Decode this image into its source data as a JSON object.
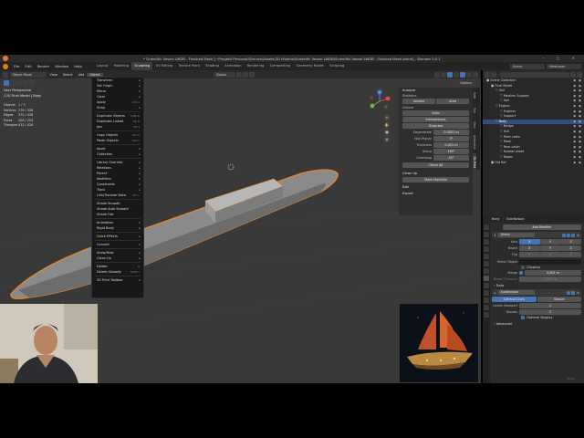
{
  "window": {
    "title": "* Scientific Vessel LWDB - Finished Mesh [~Progetti Personali\\Secure\\Assets\\3D Models\\Scientific Vessel LWDB\\Scientific Vessel LWDB - Finished Mesh.blend] - Blender 5.0.1",
    "buttons": "–  ▢  ✕"
  },
  "menus": [
    "File",
    "Edit",
    "Render",
    "Window",
    "Help"
  ],
  "workspaces": [
    "Layout",
    "Modeling",
    "Sculpting",
    "UV Editing",
    "Texture Paint",
    "Shading",
    "Animation",
    "Rendering",
    "Compositing",
    "Geometry Nodes",
    "Scripting"
  ],
  "active_workspace_index": 2,
  "scene": {
    "label": "Scene",
    "view_layer": "ViewLayer"
  },
  "viewport_header": {
    "mode": "Object Mode",
    "menus": [
      "View",
      "Select",
      "Add",
      "Object"
    ],
    "orientation": "Global",
    "options": "Options"
  },
  "viewport_overlay": {
    "line1": "User Perspective",
    "line2": "(10) Final Model | Body"
  },
  "stats": [
    {
      "k": "Objects",
      "v": "1 / 3"
    },
    {
      "k": "Vertices",
      "v": "276 / 328"
    },
    {
      "k": "Edges",
      "v": "370 / 436"
    },
    {
      "k": "Faces",
      "v": "208 / 254"
    },
    {
      "k": "Triangles",
      "v": "412 / 428"
    }
  ],
  "object_menu": [
    {
      "label": "Transform",
      "arrow": "▸"
    },
    {
      "label": "Set Origin",
      "arrow": "▸"
    },
    {
      "label": "Mirror",
      "arrow": "▸"
    },
    {
      "label": "Clear",
      "arrow": "▸"
    },
    {
      "label": "Apply",
      "sc": "Ctrl A"
    },
    {
      "label": "Snap",
      "arrow": "▸"
    },
    {
      "sep": true
    },
    {
      "label": "Duplicate Objects",
      "sc": "Shift D"
    },
    {
      "label": "Duplicate Linked",
      "sc": "Alt D"
    },
    {
      "label": "Join",
      "sc": "Ctrl J"
    },
    {
      "sep": true
    },
    {
      "label": "Copy Objects",
      "sc": "Ctrl C"
    },
    {
      "label": "Paste Objects",
      "sc": "Ctrl V"
    },
    {
      "sep": true
    },
    {
      "label": "Asset",
      "arrow": "▸"
    },
    {
      "label": "Collection",
      "arrow": "▸"
    },
    {
      "sep": true
    },
    {
      "label": "Library Override",
      "arrow": "▸"
    },
    {
      "label": "Relations",
      "arrow": "▸"
    },
    {
      "label": "Parent",
      "arrow": "▸"
    },
    {
      "label": "Modifiers",
      "arrow": "▸"
    },
    {
      "label": "Constraints",
      "arrow": "▸"
    },
    {
      "label": "Track",
      "arrow": "▸"
    },
    {
      "label": "Link/Transfer Data",
      "sc": "Ctrl L"
    },
    {
      "sep": true
    },
    {
      "label": "Shade Smooth"
    },
    {
      "label": "Shade Auto Smooth"
    },
    {
      "label": "Shade Flat"
    },
    {
      "sep": true
    },
    {
      "label": "Animation",
      "arrow": "▸"
    },
    {
      "label": "Rigid Body",
      "arrow": "▸"
    },
    {
      "sep": true
    },
    {
      "label": "Quick Effects",
      "arrow": "▸"
    },
    {
      "sep": true
    },
    {
      "label": "Convert",
      "arrow": "▸"
    },
    {
      "sep": true
    },
    {
      "label": "Show/Hide",
      "arrow": "▸"
    },
    {
      "label": "Clean Up",
      "arrow": "▸"
    },
    {
      "sep": true
    },
    {
      "label": "Delete",
      "sc": "X"
    },
    {
      "label": "Delete Globally",
      "sc": "Shift X"
    },
    {
      "sep": true
    },
    {
      "label": "3D Print Toolbox",
      "arrow": "▸"
    }
  ],
  "npanel": {
    "analyze": "Analyze",
    "statistics": "Statistics",
    "volume": "Volume",
    "area": "Area",
    "checks": "Checks",
    "solid": "Solid",
    "intersections": "Intersections",
    "distorted": "Distorted",
    "fields": [
      {
        "k": "Degenerate",
        "v": "0.0001 m"
      },
      {
        "k": "Non-Planar",
        "v": "5°"
      },
      {
        "k": "Thickness",
        "v": "0.001 m"
      },
      {
        "k": "Sharp",
        "v": "160°"
      },
      {
        "k": "Overhang",
        "v": "45°"
      }
    ],
    "check_all": "Check All",
    "clean_up": "Clean Up",
    "make_manifold": "Make Manifold",
    "edit": "Edit",
    "export": "Export",
    "tabs": [
      "Item",
      "Tool",
      "View",
      "Animation",
      "3D-Print"
    ]
  },
  "outliner": {
    "search": "",
    "rows": [
      {
        "t": "Scene Collection",
        "d": 0
      },
      {
        "t": "Final Model",
        "d": 1
      },
      {
        "t": "Sail",
        "d": 2
      },
      {
        "t": "Medium Support",
        "d": 3
      },
      {
        "t": "Sail",
        "d": 3
      },
      {
        "t": "Engine",
        "d": 2
      },
      {
        "t": "Engines",
        "d": 3
      },
      {
        "t": "Support",
        "d": 3
      },
      {
        "t": "Body",
        "d": 2,
        "sel": true
      },
      {
        "t": "Bridge",
        "d": 3
      },
      {
        "t": "Hull",
        "d": 3
      },
      {
        "t": "Main cabin",
        "d": 3
      },
      {
        "t": "Mast",
        "d": 3
      },
      {
        "t": "Rear cabin",
        "d": 3
      },
      {
        "t": "Rudder sheet",
        "d": 3
      },
      {
        "t": "Ropes",
        "d": 3
      },
      {
        "t": "Old Ref",
        "d": 1
      }
    ]
  },
  "properties": {
    "object": "Body",
    "modifier_name": "Subdivision",
    "add_modifier": "Add Modifier",
    "mirror": {
      "name": "Mirror",
      "axis": "Axis",
      "bisect": "Bisect",
      "flip": "Flip",
      "x": "X",
      "y": "Y",
      "z": "Z",
      "mirror_object": "Mirror Object",
      "clipping": "Clipping",
      "merge": "Merge",
      "merge_val": "0.001 m",
      "bisect_distance": "Bisect Distance",
      "bisect_val": "0.001 m",
      "data": "Data"
    },
    "subsurf": {
      "name": "Subdivision",
      "catmull": "Catmull-Clark",
      "simple": "Simple",
      "levels_viewport": "Levels Viewport",
      "levels_viewport_val": "1",
      "render": "Render",
      "render_val": "2",
      "optimal": "Optimal Display",
      "advanced": "Advanced"
    }
  },
  "status_version": "5.0.1",
  "colors": {
    "accent": "#4772b3",
    "selection": "#e8862a",
    "blender_logo": "#e87d0d"
  }
}
